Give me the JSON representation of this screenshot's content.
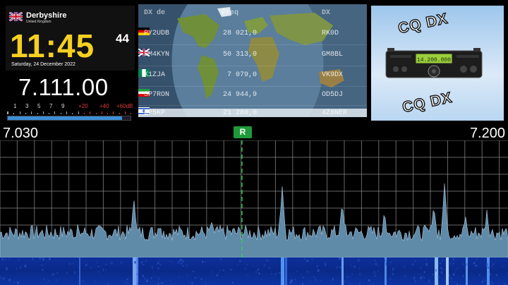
{
  "clock": {
    "location": "Derbyshire",
    "country": "United Kingdom",
    "time_hm": "11:45",
    "time_s": "44",
    "date": "Saturday, 24 December 2022",
    "flag_icon": "uk-flag-icon"
  },
  "radio": {
    "frequency": "7.111.00",
    "smeter_labels": [
      "1",
      "3",
      "5",
      "7",
      "9",
      "+20",
      "+40",
      "+60dB"
    ],
    "smeter_level": 0.93
  },
  "cluster": {
    "headers": {
      "spotter": "DX de",
      "freq": "Freq",
      "dx": "DX"
    },
    "spots": [
      {
        "spotter": "PY2UDB",
        "freq": "28 021,0",
        "flag": "germany-flag-icon",
        "dx": "RK0D"
      },
      {
        "spotter": "SM4KYN",
        "freq": "50 313,0",
        "flag": "uk-flag-icon",
        "dx": "GM8BL"
      },
      {
        "spotter": "K1ZJA",
        "freq": "7 079,0",
        "flag": "nigeria-flag-icon",
        "dx": "VK9DX"
      },
      {
        "spotter": "SP7RON",
        "freq": "24 944,9",
        "flag": "iran-flag-icon",
        "dx": "OD5DJ"
      },
      {
        "spotter": "SP5KP",
        "freq": "21 280,0",
        "flag": "israel-flag-icon",
        "dx": "4Z8NER"
      }
    ]
  },
  "promo": {
    "top_text": "CQ DX",
    "bottom_text": "CQ DX",
    "radio_display": "14.200.000"
  },
  "spectrum": {
    "start_freq": "7.030",
    "end_freq": "7.200",
    "rx_marker": "R",
    "colors": {
      "trace": "#5f8aa8",
      "grid": "#888888",
      "rx_line": "#2fd04e",
      "waterfall": "#0a2a88",
      "accent": "#f5d020"
    }
  }
}
